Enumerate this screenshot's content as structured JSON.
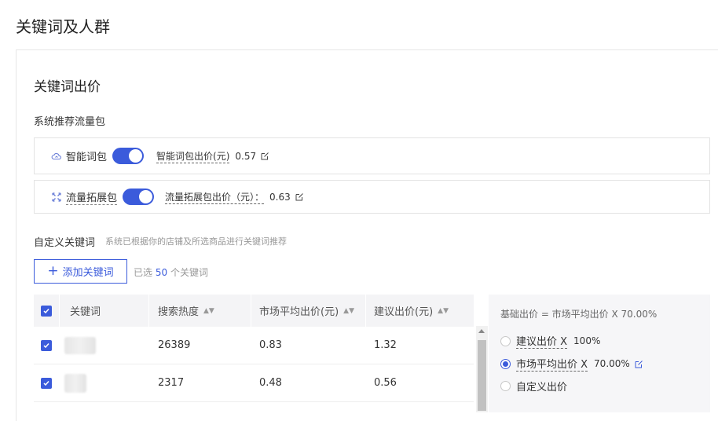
{
  "page_title": "关键词及人群",
  "section_title": "关键词出价",
  "recommend_title": "系统推荐流量包",
  "packages": [
    {
      "name": "智能词包",
      "enabled": true,
      "price_label": "智能词包出价(元)",
      "price": "0.57"
    },
    {
      "name": "流量拓展包",
      "enabled": true,
      "price_label": "流量拓展包出价（元）：",
      "price": "0.63"
    }
  ],
  "custom": {
    "title": "自定义关键词",
    "hint": "系统已根据你的店铺及所选商品进行关键词推荐",
    "add_button": "添加关键词",
    "selected_prefix": "已选",
    "selected_count": "50",
    "selected_suffix": "个关键词"
  },
  "table": {
    "headers": [
      "关键词",
      "搜索热度",
      "市场平均出价(元)",
      "建议出价(元)"
    ],
    "rows": [
      {
        "heat": "26389",
        "avg": "0.83",
        "suggest": "1.32"
      },
      {
        "heat": "2317",
        "avg": "0.48",
        "suggest": "0.56"
      }
    ]
  },
  "bid_panel": {
    "formula": "基础出价 = 市场平均出价 X 70.00%",
    "options": [
      {
        "label": "建议出价 X",
        "value": "100%",
        "checked": false
      },
      {
        "label": "市场平均出价 X",
        "value": "70.00%",
        "checked": true
      },
      {
        "label": "自定义出价",
        "value": "",
        "checked": false
      }
    ]
  },
  "colors": {
    "accent": "#3b5bdb"
  }
}
